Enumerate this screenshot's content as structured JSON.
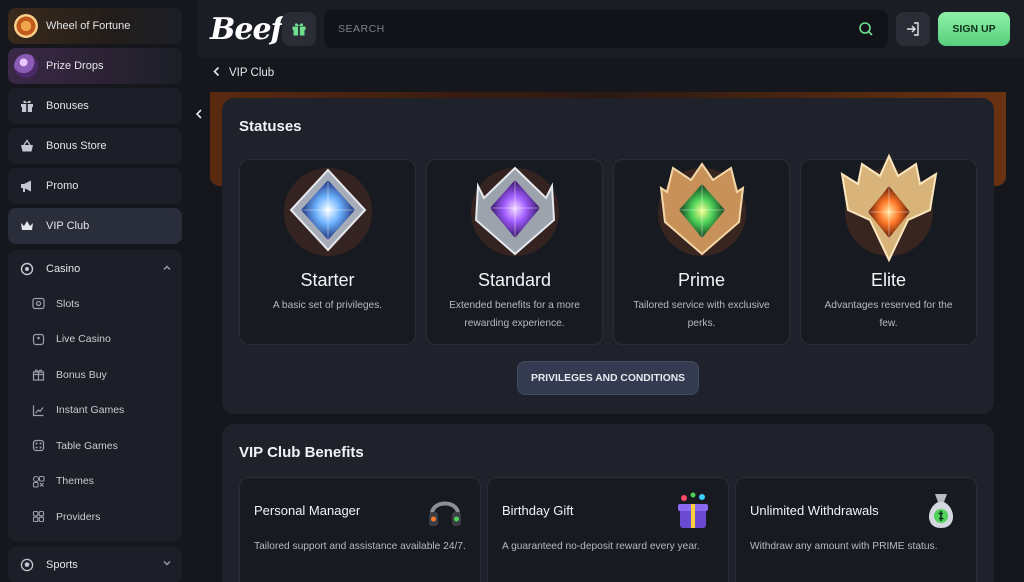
{
  "sidebar": {
    "items": [
      {
        "label": "Wheel of Fortune",
        "icon": "wheel-of-fortune-icon"
      },
      {
        "label": "Prize Drops",
        "icon": "prize-drops-icon"
      },
      {
        "label": "Bonuses",
        "icon": "gift-icon"
      },
      {
        "label": "Bonus Store",
        "icon": "basket-icon"
      },
      {
        "label": "Promo",
        "icon": "megaphone-icon"
      },
      {
        "label": "VIP Club",
        "icon": "crown-icon",
        "active": true
      }
    ],
    "casino": {
      "label": "Casino",
      "expanded": true,
      "sub_items": [
        {
          "label": "Slots",
          "icon": "slots-icon"
        },
        {
          "label": "Live Casino",
          "icon": "live-casino-icon"
        },
        {
          "label": "Bonus Buy",
          "icon": "bonus-buy-icon"
        },
        {
          "label": "Instant Games",
          "icon": "instant-games-icon"
        },
        {
          "label": "Table Games",
          "icon": "dice-icon"
        },
        {
          "label": "Themes",
          "icon": "themes-icon"
        },
        {
          "label": "Providers",
          "icon": "providers-icon"
        }
      ]
    },
    "sports": {
      "label": "Sports",
      "icon": "ball-icon"
    }
  },
  "header": {
    "logo": "Beef",
    "search_placeholder": "SEARCH",
    "signup_label": "SIGN UP"
  },
  "breadcrumb": {
    "label": "VIP Club"
  },
  "statuses": {
    "title": "Statuses",
    "cards": [
      {
        "name": "Starter",
        "desc": "A basic set of privileges.",
        "gem": "#5fa8ff"
      },
      {
        "name": "Standard",
        "desc": "Extended benefits for a more rewarding experience.",
        "gem": "#a05cff"
      },
      {
        "name": "Prime",
        "desc": "Tailored service with exclusive perks.",
        "gem": "#4fd25a"
      },
      {
        "name": "Elite",
        "desc": "Advantages reserved for the few.",
        "gem": "#ff7a2a"
      }
    ],
    "button_label": "PRIVILEGES AND CONDITIONS"
  },
  "benefits": {
    "title": "VIP Club Benefits",
    "cards": [
      {
        "title": "Personal Manager",
        "desc": "Tailored support and assistance available 24/7.",
        "icon": "headset-icon"
      },
      {
        "title": "Birthday Gift",
        "desc": "A guaranteed no-deposit reward every year.",
        "icon": "gift-box-icon"
      },
      {
        "title": "Unlimited Withdrawals",
        "desc": "Withdraw any amount with PRIME status.",
        "icon": "money-bag-icon"
      }
    ]
  },
  "colors": {
    "accent_green": "#57cf7b",
    "panel_bg": "#1f222b",
    "page_bg": "#15171d"
  }
}
